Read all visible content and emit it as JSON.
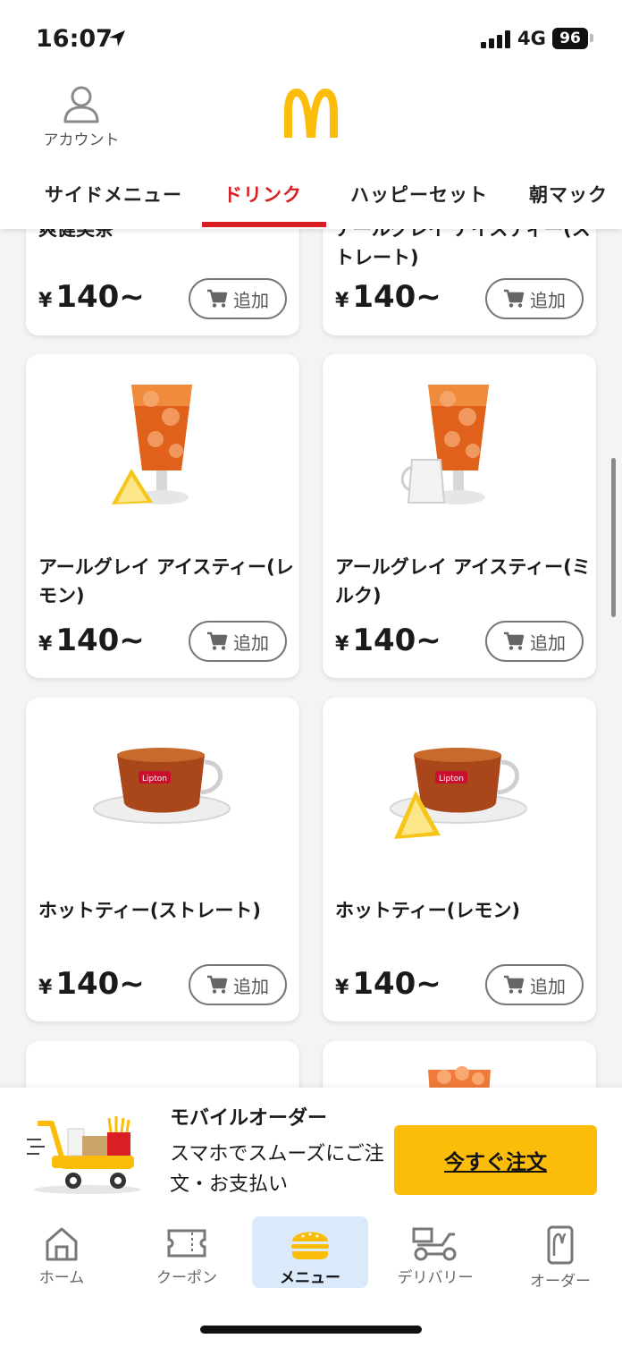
{
  "status_bar": {
    "time": "16:07",
    "network": "4G",
    "battery": "96"
  },
  "header": {
    "account_label": "アカウント",
    "logo": "mcdonalds-golden-arches-logo"
  },
  "category_tabs": [
    {
      "label": "サイドメニュー",
      "active": false
    },
    {
      "label": "ドリンク",
      "active": true
    },
    {
      "label": "ハッピーセット",
      "active": false
    },
    {
      "label": "朝マック",
      "active": false
    }
  ],
  "products": [
    {
      "name": "爽健美茶",
      "yen": "¥",
      "price": "140~",
      "add_label": "追加"
    },
    {
      "name": "アールグレイ アイスティー(ストレート)",
      "yen": "¥",
      "price": "140~",
      "add_label": "追加"
    },
    {
      "name": "アールグレイ アイスティー(レモン)",
      "yen": "¥",
      "price": "140~",
      "add_label": "追加",
      "image": "iced-tea-lemon"
    },
    {
      "name": "アールグレイ アイスティー(ミルク)",
      "yen": "¥",
      "price": "140~",
      "add_label": "追加",
      "image": "iced-tea-milk"
    },
    {
      "name": "ホットティー(ストレート)",
      "yen": "¥",
      "price": "140~",
      "add_label": "追加",
      "image": "hot-tea-cup"
    },
    {
      "name": "ホットティー(レモン)",
      "yen": "¥",
      "price": "140~",
      "add_label": "追加",
      "image": "hot-tea-lemon"
    }
  ],
  "banner": {
    "title": "モバイルオーダー",
    "description": "スマホでスムーズにご注文・お支払い",
    "cta_label": "今すぐ注文"
  },
  "bottom_nav": [
    {
      "label": "ホーム",
      "icon": "home-icon",
      "active": false
    },
    {
      "label": "クーポン",
      "icon": "coupon-icon",
      "active": false
    },
    {
      "label": "メニュー",
      "icon": "burger-icon",
      "active": true
    },
    {
      "label": "デリバリー",
      "icon": "delivery-scooter-icon",
      "active": false
    },
    {
      "label": "オーダー",
      "icon": "mobile-order-icon",
      "active": false
    }
  ],
  "colors": {
    "brand_red": "#d91e24",
    "brand_yellow": "#fbbc0a",
    "active_nav_bg": "#dbeafb"
  }
}
